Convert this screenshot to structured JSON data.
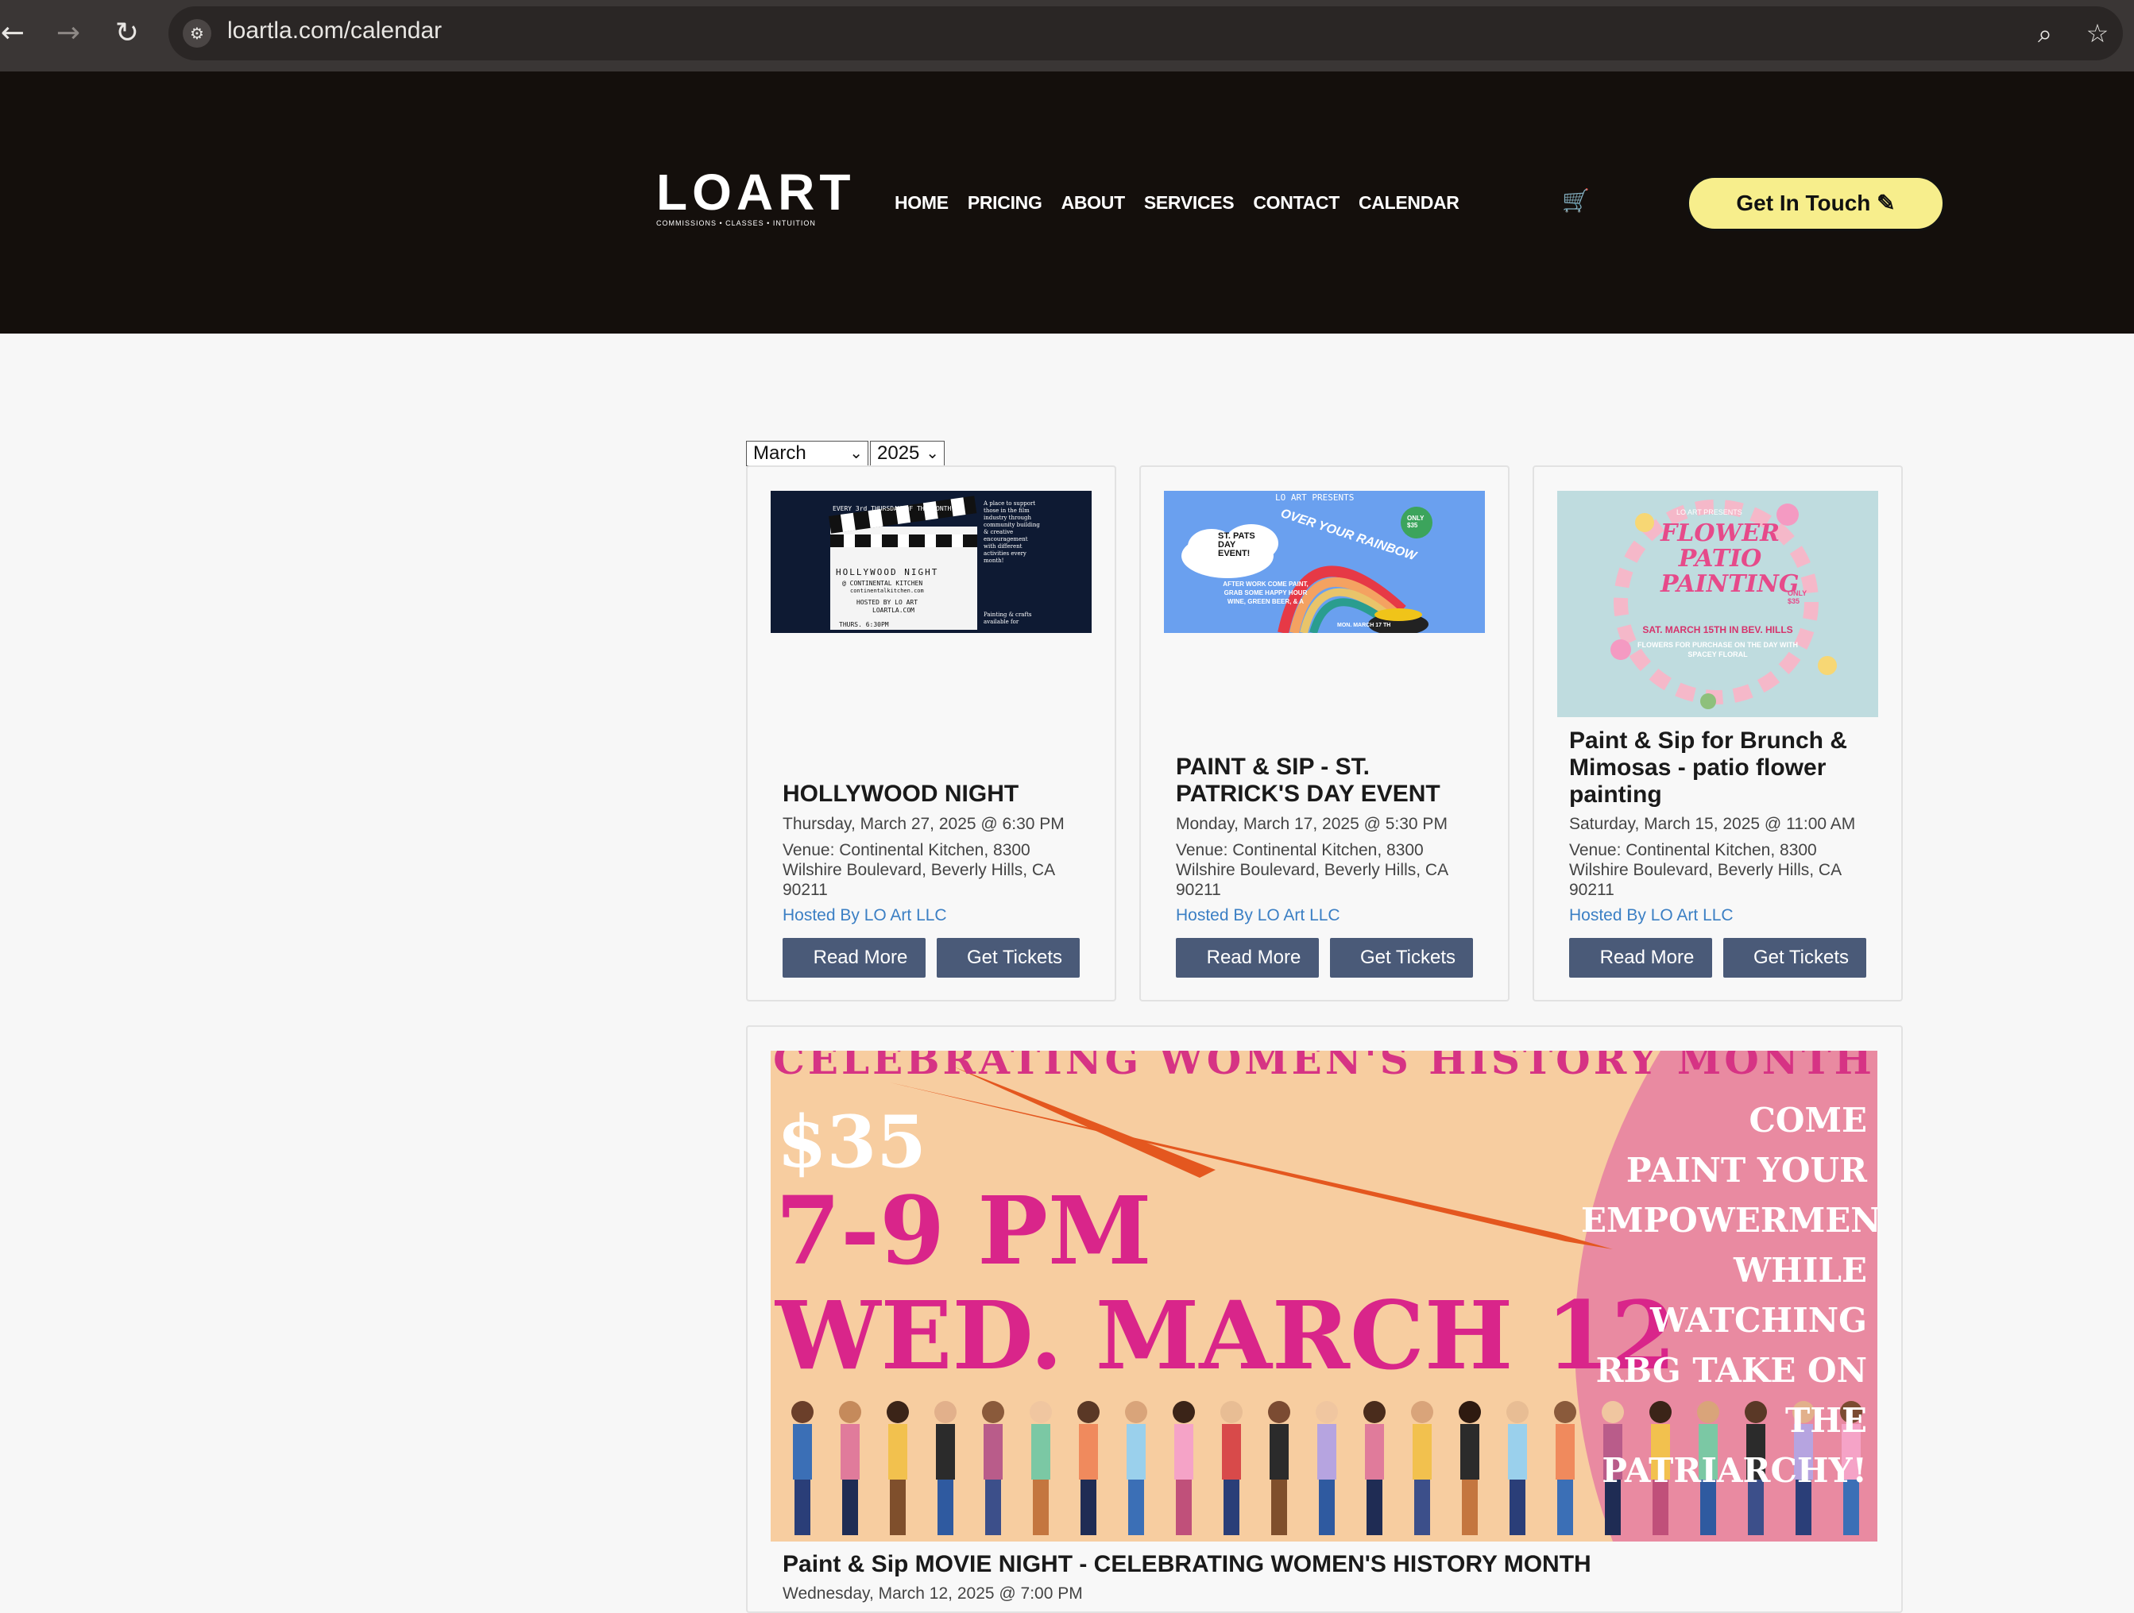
{
  "browser": {
    "url": "loartla.com/calendar",
    "back_icon": "←",
    "forward_icon": "→",
    "reload_icon": "↻",
    "zoom_icon": "⌕",
    "bookmark_icon": "☆"
  },
  "header": {
    "logo_text": "LOART",
    "logo_tagline": "COMMISSIONS • CLASSES • INTUITION",
    "nav": [
      "HOME",
      "PRICING",
      "ABOUT",
      "SERVICES",
      "CONTACT",
      "CALENDAR"
    ],
    "cta_label": "Get In Touch ✎"
  },
  "filters": {
    "month": "March",
    "year": "2025"
  },
  "events": [
    {
      "title": "HOLLYWOOD NIGHT",
      "date": "Thursday, March 27, 2025 @ 6:30 PM",
      "venue": "Venue: Continental Kitchen, 8300 Wilshire Boulevard, Beverly Hills, CA 90211",
      "host": "Hosted By LO Art LLC",
      "read_more": "Read More",
      "tickets": "Get Tickets",
      "image_text": [
        "EVERY 3rd THURSDAY OF THE MONTH",
        "HOLLYWOOD NIGHT",
        "@ CONTINENTAL KITCHEN",
        "continentalkitchen.com",
        "HOSTED BY LO ART",
        "LOARTLA.COM",
        "THURS. 6:30PM",
        "A place to support those in the film industry through community building & creative encouragement with different activities every month!",
        "Painting & crafts available for"
      ]
    },
    {
      "title": "PAINT & SIP - ST. PATRICK'S DAY EVENT",
      "date": "Monday, March 17, 2025 @ 5:30 PM",
      "venue": "Venue: Continental Kitchen, 8300 Wilshire Boulevard, Beverly Hills, CA 90211",
      "host": "Hosted By LO Art LLC",
      "read_more": "Read More",
      "tickets": "Get Tickets",
      "image_text": [
        "LO ART PRESENTS",
        "OVER YOUR RAINBOW",
        "ST. PATS DAY EVENT!",
        "ONLY $35",
        "AFTER WORK COME PAINT, GRAB SOME HAPPY HOUR WINE, GREEN BEER, & A",
        "MON. MARCH 17 TH"
      ]
    },
    {
      "title": "Paint & Sip for Brunch & Mimosas - patio flower painting",
      "date": "Saturday, March 15, 2025 @ 11:00 AM",
      "venue": "Venue: Continental Kitchen, 8300 Wilshire Boulevard, Beverly Hills, CA 90211",
      "host": "Hosted By LO Art LLC",
      "read_more": "Read More",
      "tickets": "Get Tickets",
      "image_text": [
        "LO ART PRESENTS",
        "FLOWER PATIO PAINTING",
        "ONLY $35",
        "SAT. MARCH 15TH IN BEV. HILLS",
        "FLOWERS FOR PURCHASE ON THE DAY WITH SPACEY FLORAL"
      ]
    },
    {
      "title": "Paint & Sip MOVIE NIGHT - CELEBRATING WOMEN'S HISTORY MONTH",
      "date": "Wednesday, March 12, 2025 @ 7:00 PM",
      "image_text": {
        "banner": "CELEBRATING WOMEN'S HISTORY MONTH",
        "price": "$35",
        "time": "7-9 PM",
        "day": "WED. MARCH 12",
        "right": [
          "COME",
          "PAINT YOUR",
          "EMPOWERMENT",
          "WHILE WATCHING",
          "RBG TAKE ON",
          "THE PATRIARCHY!"
        ]
      }
    }
  ],
  "colors": {
    "header_bg": "#140f0c",
    "cta_bg": "#f7ee8c",
    "button_bg": "#4a5a78",
    "link": "#3b7fc4"
  }
}
